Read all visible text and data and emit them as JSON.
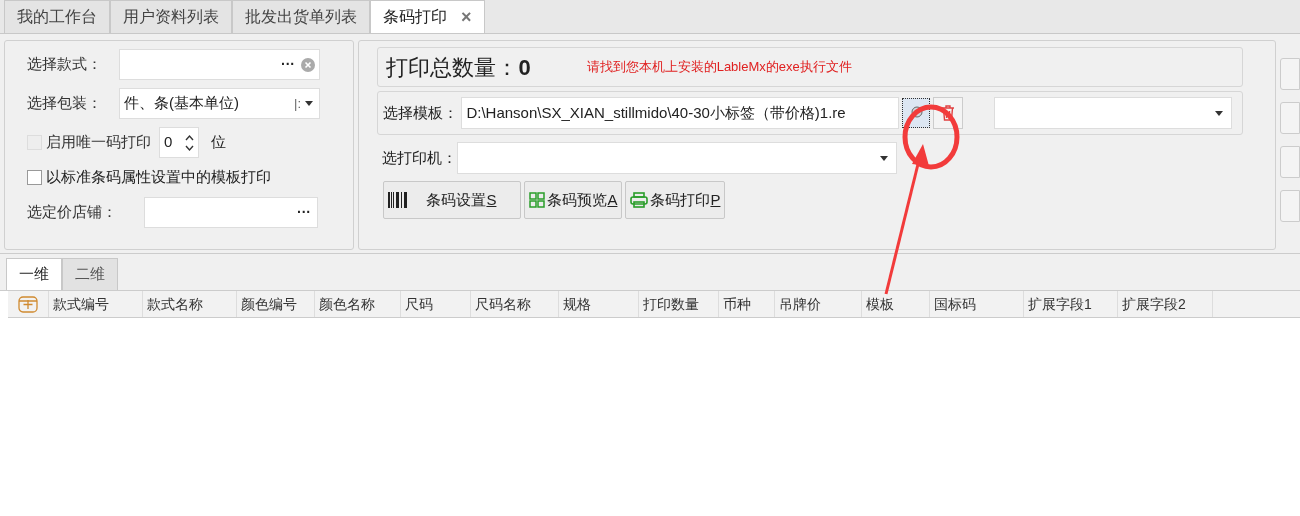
{
  "tabs": [
    {
      "label": "我的工作台",
      "selected": false,
      "closable": false
    },
    {
      "label": "用户资料列表",
      "selected": false,
      "closable": false
    },
    {
      "label": "批发出货单列表",
      "selected": false,
      "closable": false
    },
    {
      "label": "条码打印",
      "selected": true,
      "closable": true
    }
  ],
  "close_glyph": "×",
  "left_panel": {
    "style_field": {
      "label": "选择款式：",
      "ellipsis": "···"
    },
    "package_field": {
      "label": "选择包装：",
      "value": "件、条(基本单位)",
      "sep": "|:"
    },
    "unique_code": {
      "label": "启用唯一码打印",
      "checked": false,
      "disabled": true,
      "digits": "0",
      "unit": "位"
    },
    "standard_template": {
      "label": "以标准条码属性设置中的模板打印",
      "checked": false
    },
    "store_field": {
      "label": "选定价店铺：",
      "ellipsis": "···"
    }
  },
  "main_panel": {
    "total_label": "打印总数量：",
    "total_value": "0",
    "notice": "请找到您本机上安装的LableMx的exe执行文件",
    "template_label": "选择模板：",
    "template_path": "D:\\Hanson\\SX_XIAN_stillmido\\40-30小标签（带价格)1.re",
    "printer_label": "选打印机：",
    "buttons": [
      {
        "kind": "barcode",
        "label": "条码设置",
        "key": "S"
      },
      {
        "kind": "grid",
        "label": "条码预览",
        "key": "A"
      },
      {
        "kind": "printer",
        "label": "条码打印",
        "key": "P"
      }
    ]
  },
  "sub_tabs": [
    {
      "label": "一维",
      "selected": true
    },
    {
      "label": "二维",
      "selected": false
    }
  ],
  "table": {
    "columns": [
      "款式编号",
      "款式名称",
      "颜色编号",
      "颜色名称",
      "尺码",
      "尺码名称",
      "规格",
      "打印数量",
      "币种",
      "吊牌价",
      "模板",
      "国标码",
      "扩展字段1",
      "扩展字段2"
    ]
  }
}
